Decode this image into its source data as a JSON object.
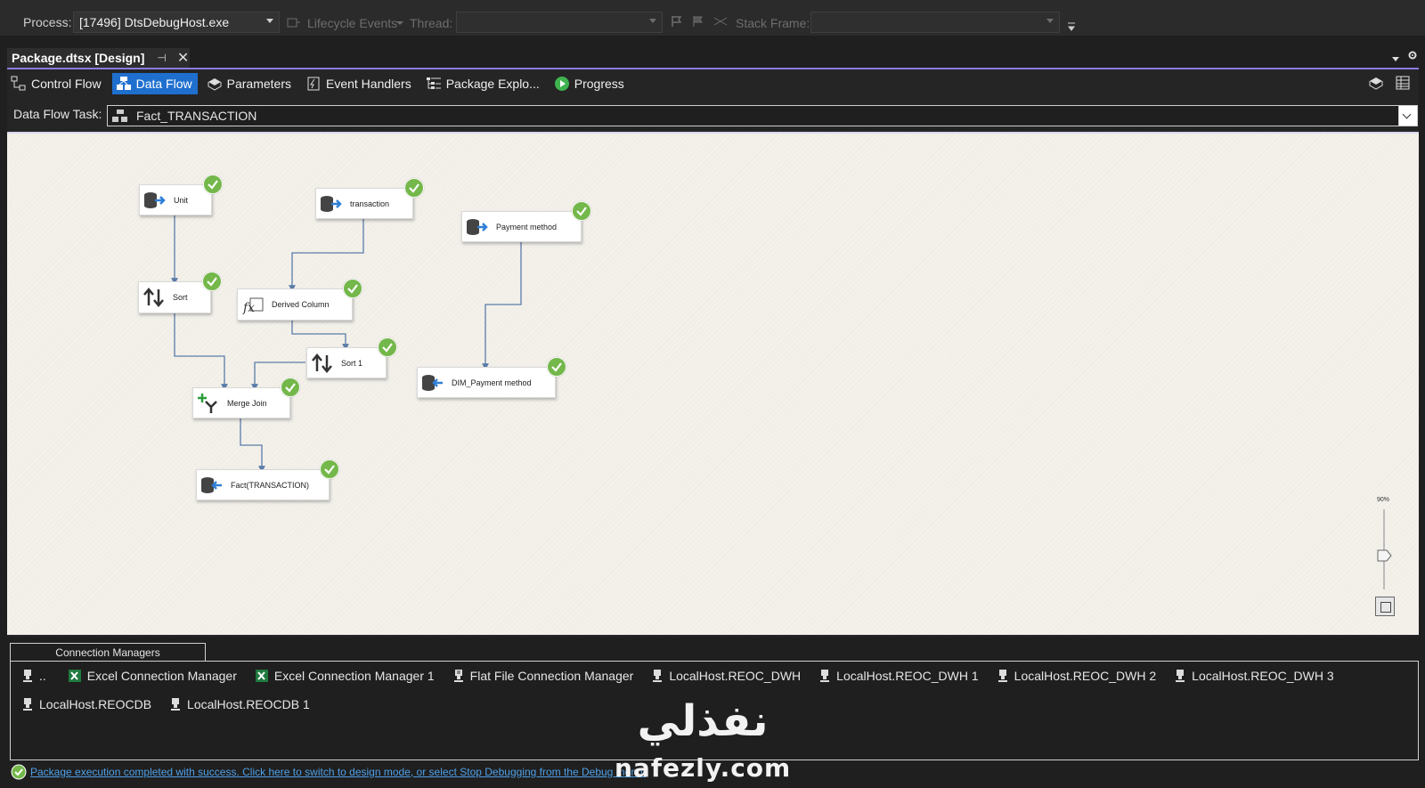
{
  "debug_toolbar": {
    "process_label": "Process:",
    "process_value": "[17496] DtsDebugHost.exe",
    "lifecycle_label": "Lifecycle Events",
    "thread_label": "Thread:",
    "stack_frame_label": "Stack Frame:"
  },
  "document_tab": {
    "title": "Package.dtsx [Design]",
    "pin_glyph": "⊣",
    "close_glyph": "✕"
  },
  "designer_tabs": [
    {
      "label": "Control Flow",
      "icon": "control-flow-icon"
    },
    {
      "label": "Data Flow",
      "icon": "data-flow-icon",
      "active": true
    },
    {
      "label": "Parameters",
      "icon": "parameters-icon"
    },
    {
      "label": "Event Handlers",
      "icon": "event-handlers-icon"
    },
    {
      "label": "Package Explo...",
      "icon": "package-explorer-icon"
    },
    {
      "label": "Progress",
      "icon": "progress-icon"
    }
  ],
  "data_flow_task": {
    "label": "Data Flow Task:",
    "value": "Fact_TRANSACTION"
  },
  "nodes": {
    "unit": "Unit",
    "transaction": "transaction",
    "payment_method": "Payment method",
    "sort": "Sort",
    "derived_column": "Derived Column",
    "sort_1": "Sort 1",
    "dim_payment_method": "DIM_Payment method",
    "merge_join": "Merge Join",
    "fact_transaction": "Fact(TRANSACTION)"
  },
  "zoom": {
    "label": "90%",
    "percent": 90
  },
  "connection_managers": {
    "tab_label": "Connection Managers",
    "items": [
      "..",
      "Excel Connection Manager",
      "Excel Connection Manager 1",
      "Flat File Connection Manager",
      "LocalHost.REOC_DWH",
      "LocalHost.REOC_DWH 1",
      "LocalHost.REOC_DWH 2",
      "LocalHost.REOC_DWH 3",
      "LocalHost.REOCDB",
      "LocalHost.REOCDB 1"
    ]
  },
  "status": {
    "message": "Package execution completed with success. Click here to switch to design mode, or select Stop Debugging from the Debug menu."
  },
  "watermark": {
    "arabic": "نفذلي",
    "latin": "nafezly.com"
  },
  "colors": {
    "accent_purple": "#8a7be0",
    "active_tab_blue": "#1f6fcf",
    "success_green": "#74b74a",
    "link_blue": "#4ea0e8",
    "canvas_bg": "#f3f1ea"
  }
}
